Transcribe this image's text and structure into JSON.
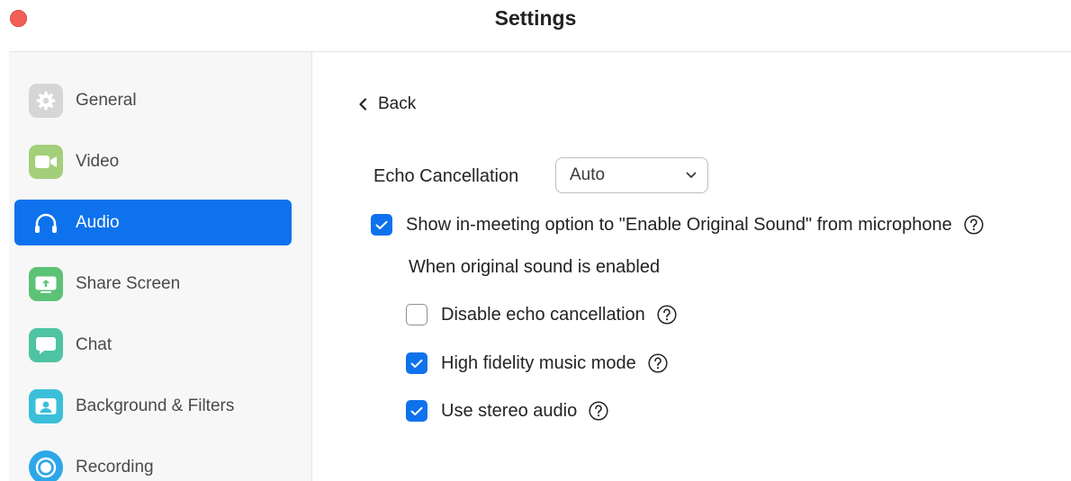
{
  "window": {
    "title": "Settings"
  },
  "sidebar": {
    "items": [
      {
        "label": "General",
        "icon": "gear-icon",
        "color": "#d6d6d6"
      },
      {
        "label": "Video",
        "icon": "video-camera-icon",
        "color": "#a4cf7a"
      },
      {
        "label": "Audio",
        "icon": "headphones-icon",
        "color": "#0e72ed",
        "active": true
      },
      {
        "label": "Share Screen",
        "icon": "share-screen-icon",
        "color": "#5cc276"
      },
      {
        "label": "Chat",
        "icon": "chat-bubble-icon",
        "color": "#4ec4a2"
      },
      {
        "label": "Background & Filters",
        "icon": "background-person-icon",
        "color": "#3bbfd9"
      },
      {
        "label": "Recording",
        "icon": "record-icon",
        "color": "#2ea7e8"
      }
    ]
  },
  "main": {
    "back_label": "Back",
    "echo": {
      "label": "Echo Cancellation",
      "selected": "Auto"
    },
    "original_sound": {
      "label": "Show in-meeting option to \"Enable Original Sound\" from microphone",
      "checked": true
    },
    "subheading": "When original sound is enabled",
    "options": [
      {
        "label": "Disable echo cancellation",
        "checked": false
      },
      {
        "label": "High fidelity music mode",
        "checked": true
      },
      {
        "label": "Use stereo audio",
        "checked": true
      }
    ]
  },
  "colors": {
    "accent": "#0e72ed",
    "close": "#f25f58"
  }
}
